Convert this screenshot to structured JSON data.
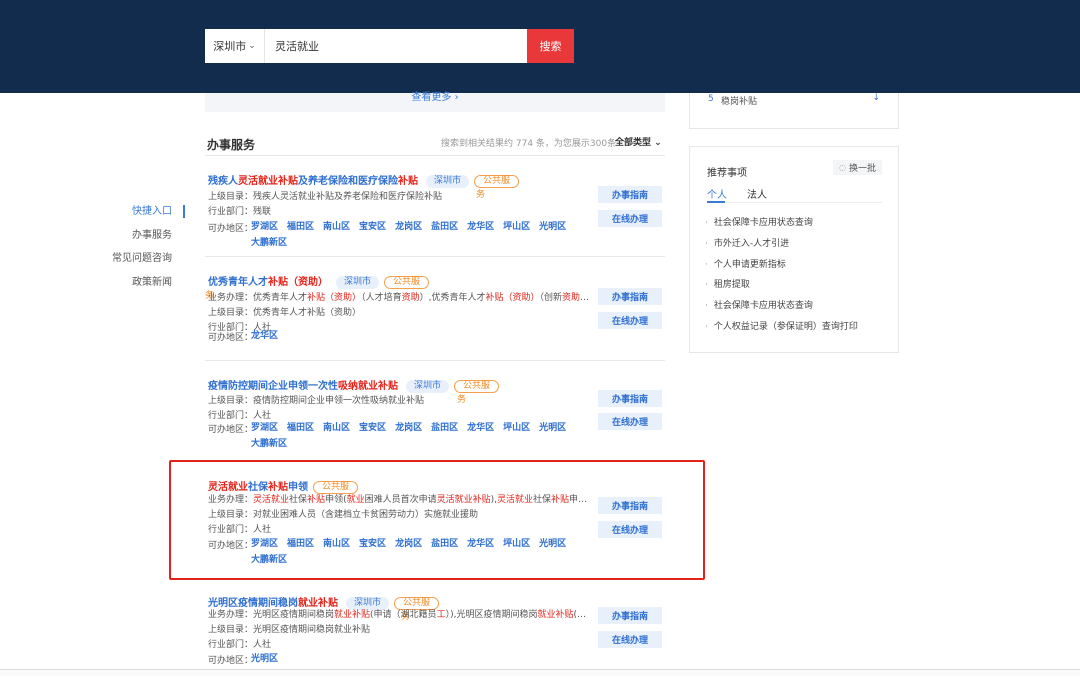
{
  "header": {
    "city": "深圳市",
    "search_value": "灵活就业",
    "search_button": "搜索"
  },
  "more_bar": {
    "label": "查看更多 ›"
  },
  "right_top": {
    "num": "5",
    "label": "稳岗补贴",
    "arrow": "↓"
  },
  "left_nav": {
    "items": [
      "快捷入口",
      "办事服务",
      "常见问题咨询",
      "政策新闻"
    ]
  },
  "section": {
    "title": "办事服务",
    "info": "搜索到相关结果约 774 条，为您展示300条",
    "filter": "全部类型 ⌄"
  },
  "items": [
    {
      "title": [
        {
          "t": "残疾人",
          "h": false
        },
        {
          "t": "灵活就业补贴",
          "h": true
        },
        {
          "t": "及养老保险和医疗保险",
          "h": false
        },
        {
          "t": "补贴",
          "h": true
        }
      ],
      "city_tag": "深圳市",
      "pub_tag": "公共服",
      "pub_wrap": "务",
      "rows": [
        [
          {
            "t": "上级目录：",
            "h": false
          },
          {
            "t": "残疾人灵活就业补贴及养老保险和医疗保险补贴",
            "h": false
          }
        ],
        [
          {
            "t": "行业部门：",
            "h": false
          },
          {
            "t": "残联",
            "h": false
          }
        ]
      ],
      "area_label": "可办地区：",
      "areas": [
        "罗湖区",
        "福田区",
        "南山区",
        "宝安区",
        "龙岗区",
        "盐田区",
        "龙华区",
        "坪山区",
        "光明区",
        "大鹏新区"
      ],
      "btn1": "办事指南",
      "btn2": "在线办理"
    },
    {
      "title": [
        {
          "t": "优秀青年人才",
          "h": false
        },
        {
          "t": "补贴",
          "h": true
        },
        {
          "t": "（资助）",
          "h": true
        }
      ],
      "city_tag": "深圳市",
      "pub_tag": "公共服",
      "pub_wrap": "务",
      "rows": [
        [
          {
            "t": "业务办理：",
            "h": false
          },
          {
            "t": "优秀青年人才",
            "h": false
          },
          {
            "t": "补贴",
            "h": true
          },
          {
            "t": "（资助）",
            "h": true
          },
          {
            "t": "（人才培育",
            "h": false
          },
          {
            "t": "资助",
            "h": true
          },
          {
            "t": "）,优秀青年人才",
            "h": false
          },
          {
            "t": "补贴",
            "h": true
          },
          {
            "t": "（资助）",
            "h": true
          },
          {
            "t": "（创新",
            "h": false
          },
          {
            "t": "资助",
            "h": true
          },
          {
            "t": "）,优...",
            "h": false
          }
        ],
        [
          {
            "t": "上级目录：",
            "h": false
          },
          {
            "t": "优秀青年人才补贴（资助）",
            "h": false
          }
        ],
        [
          {
            "t": "行业部门：",
            "h": false
          },
          {
            "t": "人社",
            "h": false
          }
        ]
      ],
      "area_label": "可办地区：",
      "areas": [
        "龙华区"
      ],
      "btn1": "办事指南",
      "btn2": "在线办理"
    },
    {
      "title": [
        {
          "t": "疫情防控期间企业申领一次性",
          "h": false
        },
        {
          "t": "吸纳就业补贴",
          "h": true
        }
      ],
      "city_tag": "深圳市",
      "pub_tag": "公共服",
      "pub_wrap": "务",
      "rows": [
        [
          {
            "t": "上级目录：",
            "h": false
          },
          {
            "t": "疫情防控期间企业申领一次性吸纳就业补贴",
            "h": false
          }
        ],
        [
          {
            "t": "行业部门：",
            "h": false
          },
          {
            "t": "人社",
            "h": false
          }
        ]
      ],
      "area_label": "可办地区：",
      "areas": [
        "罗湖区",
        "福田区",
        "南山区",
        "宝安区",
        "龙岗区",
        "盐田区",
        "龙华区",
        "坪山区",
        "光明区",
        "大鹏新区"
      ],
      "btn1": "办事指南",
      "btn2": "在线办理"
    },
    {
      "title": [
        {
          "t": "灵活就业",
          "h": true
        },
        {
          "t": "社保",
          "h": false
        },
        {
          "t": "补贴",
          "h": true
        },
        {
          "t": "申领",
          "h": false
        }
      ],
      "city_tag": "",
      "pub_tag": "公共服",
      "pub_wrap": "",
      "rows": [
        [
          {
            "t": "业务办理：",
            "h": false
          },
          {
            "t": "灵活就业",
            "h": true
          },
          {
            "t": "社保",
            "h": false
          },
          {
            "t": "补贴",
            "h": true
          },
          {
            "t": "申领(",
            "h": false
          },
          {
            "t": "就业",
            "h": true
          },
          {
            "t": "困难人员首次申请",
            "h": false
          },
          {
            "t": "灵活就业补贴",
            "h": true
          },
          {
            "t": "),",
            "h": false
          },
          {
            "t": "灵活就业",
            "h": true
          },
          {
            "t": "社保",
            "h": false
          },
          {
            "t": "补贴",
            "h": true
          },
          {
            "t": "申领(...",
            "h": false
          }
        ],
        [
          {
            "t": "上级目录：",
            "h": false
          },
          {
            "t": "对就业困难人员（含建档立卡贫困劳动力）实施就业援助",
            "h": false
          }
        ],
        [
          {
            "t": "行业部门：",
            "h": false
          },
          {
            "t": "人社",
            "h": false
          }
        ]
      ],
      "area_label": "可办地区：",
      "areas": [
        "罗湖区",
        "福田区",
        "南山区",
        "宝安区",
        "龙岗区",
        "盐田区",
        "龙华区",
        "坪山区",
        "光明区",
        "大鹏新区"
      ],
      "btn1": "办事指南",
      "btn2": "在线办理"
    },
    {
      "title": [
        {
          "t": "光明区疫情期间稳岗",
          "h": false
        },
        {
          "t": "就业补贴",
          "h": true
        }
      ],
      "city_tag": "深圳市",
      "pub_tag": "公共服",
      "pub_wrap": "务",
      "rows": [
        [
          {
            "t": "业务办理：",
            "h": false
          },
          {
            "t": "光明区疫情期间稳岗",
            "h": false
          },
          {
            "t": "就业补贴",
            "h": true
          },
          {
            "t": "(申请（湖北籍员",
            "h": false
          },
          {
            "t": "工",
            "h": true
          },
          {
            "t": "）),光明区疫情期间稳岗",
            "h": false
          },
          {
            "t": "就业补贴",
            "h": true
          },
          {
            "t": "(申...",
            "h": false
          }
        ],
        [
          {
            "t": "上级目录：",
            "h": false
          },
          {
            "t": "光明区疫情期间稳岗就业补贴",
            "h": false
          }
        ],
        [
          {
            "t": "行业部门：",
            "h": false
          },
          {
            "t": "人社",
            "h": false
          }
        ]
      ],
      "area_label": "可办地区：",
      "areas": [
        "光明区"
      ],
      "btn1": "办事指南",
      "btn2": "在线办理"
    }
  ],
  "recommend": {
    "title": "推荐事项",
    "change": "换一批",
    "tabs": [
      "个人",
      "法人"
    ],
    "list": [
      "社会保障卡应用状态查询",
      "市外迁入-人才引进",
      "个人申请更新指标",
      "租房提取",
      "社会保障卡应用状态查询",
      "个人权益记录（参保证明）查询打印"
    ]
  }
}
